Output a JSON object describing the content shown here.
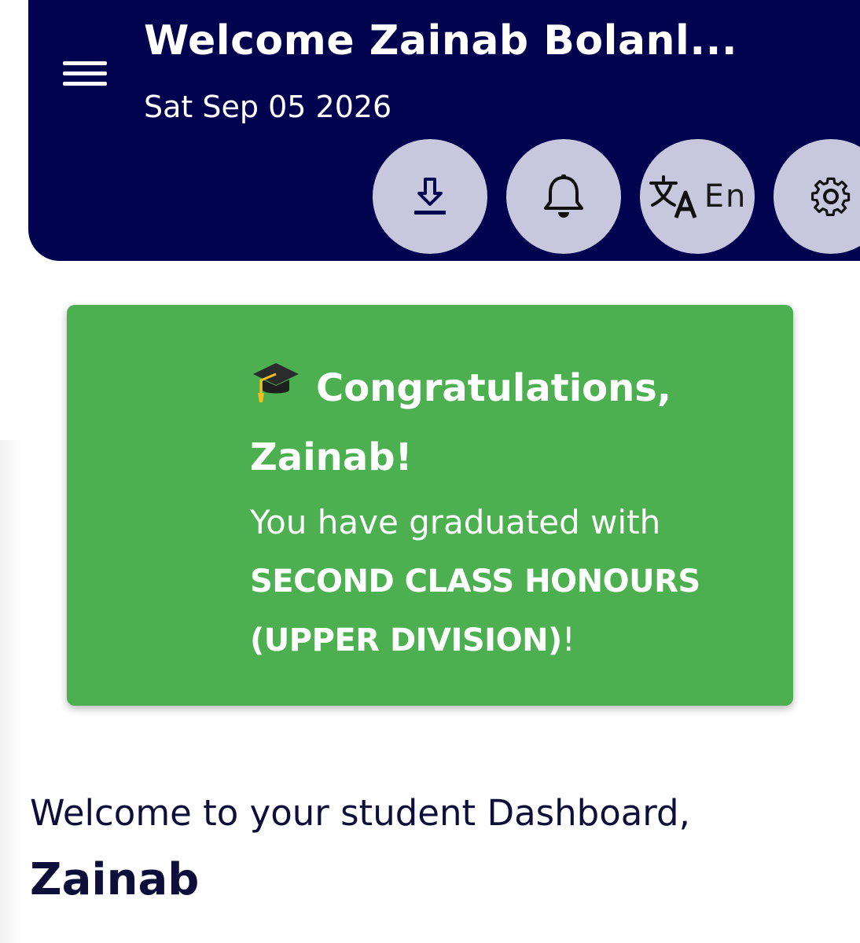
{
  "header": {
    "title": "Welcome Zainab Bolanl...",
    "date": "Sat Sep 05 2026",
    "background_color": "#02034f",
    "actions": [
      {
        "name": "download",
        "icon": "download-icon"
      },
      {
        "name": "notifications",
        "icon": "bell-icon"
      },
      {
        "name": "language",
        "icon": "translate-icon",
        "label": "En"
      },
      {
        "name": "settings",
        "icon": "gear-icon"
      }
    ]
  },
  "banner": {
    "background_color": "#4caf50",
    "icon": "graduation-cap-icon",
    "title": "Congratulations, Zainab!",
    "message_prefix": "You have graduated with ",
    "honours": "SECOND CLASS HONOURS (UPPER DIVISION)",
    "message_suffix": "!"
  },
  "welcome": {
    "text": "Welcome to your student Dashboard,",
    "name": "Zainab"
  }
}
